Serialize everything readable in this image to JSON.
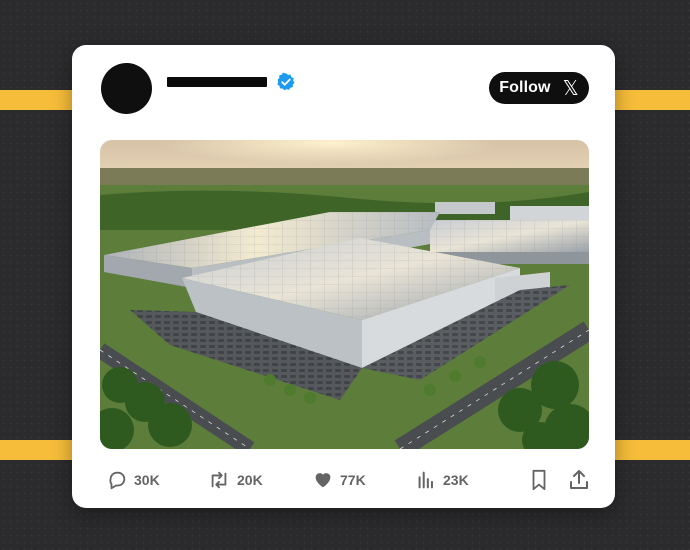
{
  "post": {
    "follow_label": "Follow",
    "brand_icon": "x-logo-icon",
    "verified_icon": "verified-badge-icon",
    "image_subject": "aerial photo of large warehouse complex with rooftop solar panels at sunset"
  },
  "actions": {
    "replies": "30K",
    "reposts": "20K",
    "likes": "77K",
    "views": "23K",
    "bookmark_icon": "bookmark-icon",
    "share_icon": "share-icon"
  },
  "colors": {
    "background": "#2b2b2d",
    "stripe": "#f6bd3a",
    "card": "#ffffff",
    "verified": "#1d9bf0",
    "follow_button": "#0f0f0f",
    "action_text": "#646464"
  }
}
